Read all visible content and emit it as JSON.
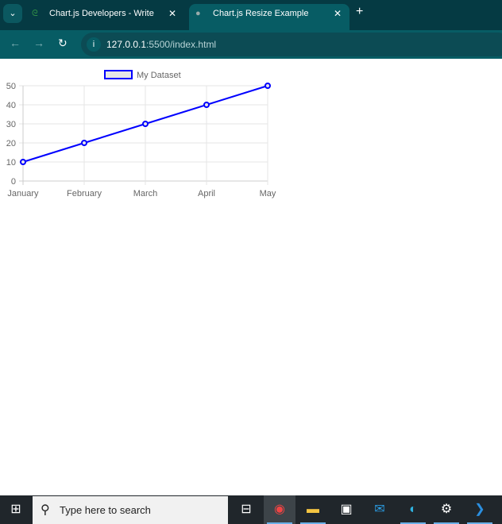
{
  "browser": {
    "tabs": [
      {
        "title": "Chart.js Developers - Write",
        "icon": "gfg-icon"
      },
      {
        "title": "Chart.js Resize Example",
        "icon": "globe-icon",
        "active": true
      }
    ],
    "url_host": "127.0.0.1",
    "url_rest": ":5500/index.html"
  },
  "taskbar": {
    "search_placeholder": "Type here to search"
  },
  "chart_data": {
    "type": "line",
    "categories": [
      "January",
      "February",
      "March",
      "April",
      "May"
    ],
    "series": [
      {
        "name": "My Dataset",
        "values": [
          10,
          20,
          30,
          40,
          50
        ],
        "color": "#0000ff",
        "fill": "#e6e6e6"
      }
    ],
    "ylim": [
      0,
      50
    ],
    "yticks": [
      0,
      10,
      20,
      30,
      40,
      50
    ],
    "grid": true,
    "legend": "top"
  }
}
